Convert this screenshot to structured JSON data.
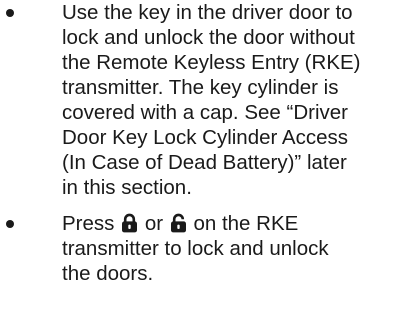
{
  "bullets": [
    {
      "lines": [
        "Use the key in the driver door to",
        "lock and unlock the door without",
        "the Remote Keyless Entry (RKE)",
        "transmitter. The key cylinder is",
        "covered with a cap. See “Driver",
        "Door Key Lock Cylinder Access",
        "(In Case of Dead Battery)” later",
        "in this section."
      ]
    },
    {
      "line1_before": "Press",
      "line1_between": "or",
      "line1_after": "on the RKE",
      "line2": "transmitter to lock and unlock",
      "line3": "the doors.",
      "icons": [
        "lock-icon",
        "unlock-icon"
      ]
    }
  ]
}
